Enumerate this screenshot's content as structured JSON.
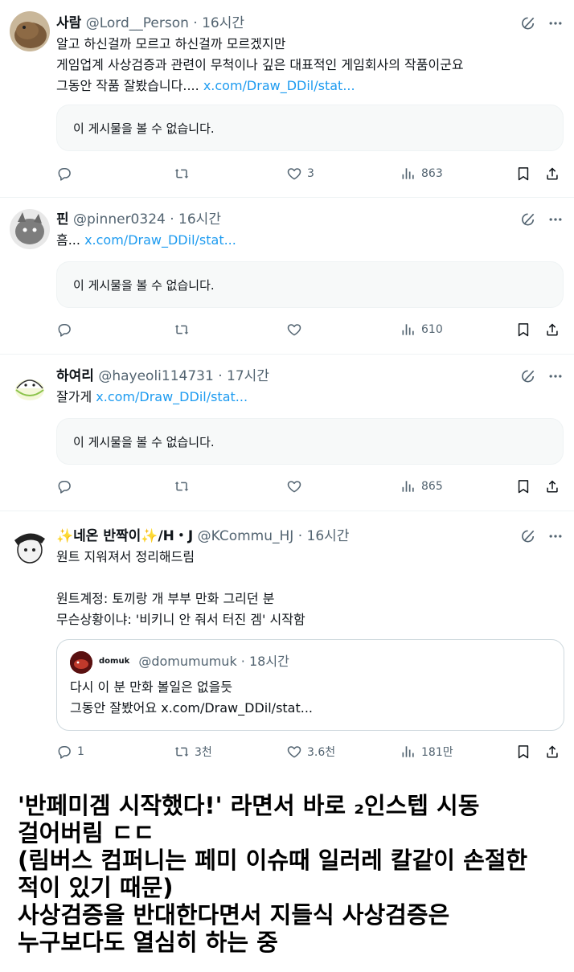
{
  "colors": {
    "link": "#1d9bf0",
    "muted": "#536471",
    "card_bg": "#f7f9f9"
  },
  "tweets": [
    {
      "name": "사람",
      "handle": "@Lord__Person",
      "dot": "·",
      "time": "16시간",
      "lines": [
        "알고 하신걸까 모르고 하신걸까 모르겠지만",
        "게임업계 사상검증과 관련이 무척이나 깊은 대표적인 게임회사의 작품이군요"
      ],
      "last_prefix": "그동안 작품 잘봤습니다....",
      "link": "x.com/Draw_DDil/stat...",
      "unavailable": "이 게시물을 볼 수 없습니다.",
      "likes": "3",
      "views": "863"
    },
    {
      "name": "핀",
      "handle": "@pinner0324",
      "dot": "·",
      "time": "16시간",
      "last_prefix": "흠...",
      "link": "x.com/Draw_DDil/stat...",
      "unavailable": "이 게시물을 볼 수 없습니다.",
      "likes": "",
      "views": "610"
    },
    {
      "name": "하여리",
      "handle": "@hayeoli114731",
      "dot": "·",
      "time": "17시간",
      "last_prefix": "잘가게",
      "link": "x.com/Draw_DDil/stat...",
      "unavailable": "이 게시물을 볼 수 없습니다.",
      "likes": "",
      "views": "865"
    },
    {
      "name": "✨네온 반짝이✨/H・J",
      "handle": "@KCommu_HJ",
      "dot": "·",
      "time": "16시간",
      "lines": [
        "원트 지워져서 정리해드림",
        "",
        "원트계정: 토끼랑 개 부부 만화 그리던 분",
        "무슨상황이냐: '비키니 안 줘서 터진 겜' 시작함"
      ],
      "quote": {
        "name": "domuk",
        "handle": "@domumumuk",
        "dot": "·",
        "time": "18시간",
        "line1": "다시 이 분 만화 볼일은 없을듯",
        "line2_prefix": "그동안 잘봤어요",
        "link": "x.com/Draw_DDil/stat..."
      },
      "replies": "1",
      "retweets": "3천",
      "likes": "3.6천",
      "views": "181만"
    }
  ],
  "caption": "'반페미겜 시작했다!' 라면서 바로 ₂인스텝 시동\n걸어버림 ㄷㄷ\n(림버스 컴퍼니는 페미 이슈때 일러레 칼같이 손절한\n적이 있기 때문)\n사상검증을 반대한다면서 지들식 사상검증은\n누구보다도 열심히 하는 중"
}
